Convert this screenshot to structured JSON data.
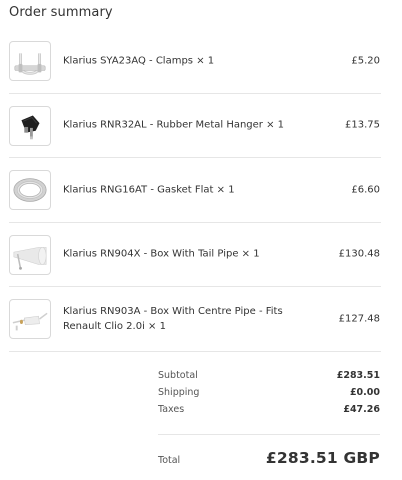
{
  "order_summary": {
    "title": "Order summary",
    "items": [
      {
        "name": "Klarius SYA23AQ - Clamps × 1",
        "price": "£5.20",
        "icon": "clamp-icon"
      },
      {
        "name": "Klarius RNR32AL - Rubber Metal Hanger × 1",
        "price": "£13.75",
        "icon": "rubber-hanger-icon"
      },
      {
        "name": "Klarius RNG16AT - Gasket Flat × 1",
        "price": "£6.60",
        "icon": "gasket-icon"
      },
      {
        "name": "Klarius RN904X - Box With Tail Pipe × 1",
        "price": "£130.48",
        "icon": "tail-pipe-box-icon"
      },
      {
        "name": "Klarius RN903A - Box With Centre Pipe - Fits Renault Clio 2.0i × 1",
        "price": "£127.48",
        "icon": "centre-pipe-box-icon"
      }
    ],
    "subtotal_label": "Subtotal",
    "subtotal_value": "£283.51",
    "shipping_label": "Shipping",
    "shipping_value": "£0.00",
    "taxes_label": "Taxes",
    "taxes_value": "£47.26",
    "total_label": "Total",
    "total_value": "£283.51 GBP"
  }
}
